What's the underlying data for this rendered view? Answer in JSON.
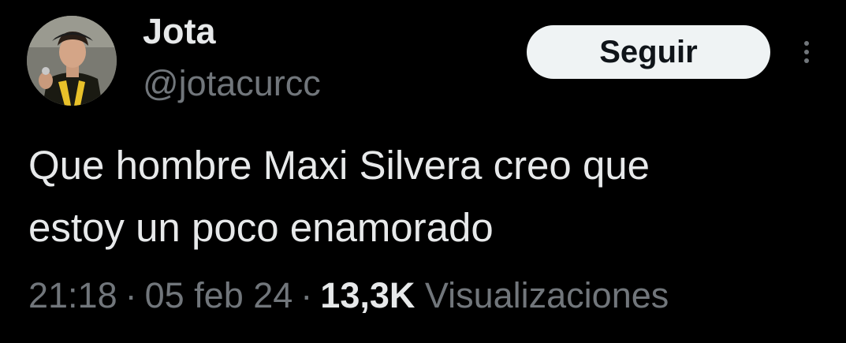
{
  "tweet": {
    "author": {
      "display_name": "Jota",
      "handle": "@jotacurcc",
      "avatar_icon": "user-avatar-photo"
    },
    "follow_label": "Seguir",
    "more_icon": "more-options-icon",
    "text": "Que hombre Maxi Silvera creo que\nestoy un poco enamorado",
    "time": "21:18",
    "date": "05 feb 24",
    "separator": "·",
    "views_count": "13,3K",
    "views_label": "Visualizaciones"
  },
  "colors": {
    "background": "#000000",
    "primary_text": "#e7e9ea",
    "secondary_text": "#71767b",
    "button_bg": "#eff3f4",
    "button_text": "#0f1419"
  }
}
